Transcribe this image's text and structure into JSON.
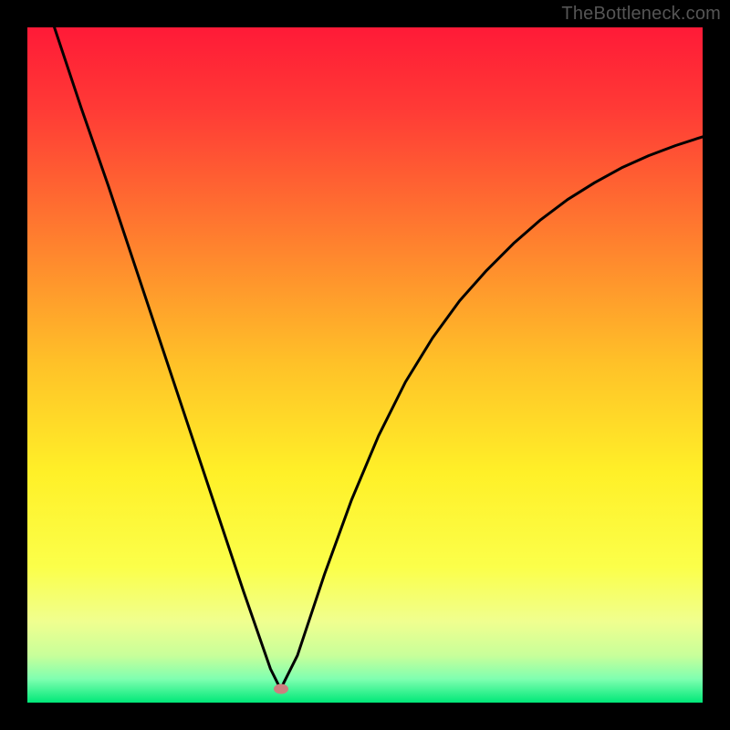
{
  "watermark": "TheBottleneck.com",
  "chart_data": {
    "type": "line",
    "title": "",
    "xlabel": "",
    "ylabel": "",
    "xlim": [
      0,
      100
    ],
    "ylim": [
      0,
      100
    ],
    "grid": false,
    "legend": false,
    "series": [
      {
        "name": "bottleneck-curve",
        "x": [
          4,
          8,
          12,
          16,
          20,
          24,
          28,
          32,
          36,
          37.5,
          40,
          44,
          48,
          52,
          56,
          60,
          64,
          68,
          72,
          76,
          80,
          84,
          88,
          92,
          96,
          100
        ],
        "y": [
          100,
          88,
          76.5,
          64.5,
          52.5,
          40.5,
          28.5,
          16.5,
          5,
          2,
          7,
          19,
          30,
          39.5,
          47.5,
          54,
          59.5,
          64,
          68,
          71.5,
          74.5,
          77,
          79.2,
          81,
          82.5,
          83.8
        ]
      }
    ],
    "minimum_marker": {
      "x": 37.5,
      "y": 2
    },
    "background_gradient": {
      "type": "vertical",
      "stops": [
        {
          "pos": 0.0,
          "color": "#ff1a37"
        },
        {
          "pos": 0.12,
          "color": "#ff3a36"
        },
        {
          "pos": 0.3,
          "color": "#ff7a2f"
        },
        {
          "pos": 0.5,
          "color": "#ffc228"
        },
        {
          "pos": 0.66,
          "color": "#fff028"
        },
        {
          "pos": 0.8,
          "color": "#fbff4a"
        },
        {
          "pos": 0.88,
          "color": "#f0ff8f"
        },
        {
          "pos": 0.93,
          "color": "#c8ff9a"
        },
        {
          "pos": 0.965,
          "color": "#7fffb0"
        },
        {
          "pos": 1.0,
          "color": "#00e878"
        }
      ]
    }
  }
}
